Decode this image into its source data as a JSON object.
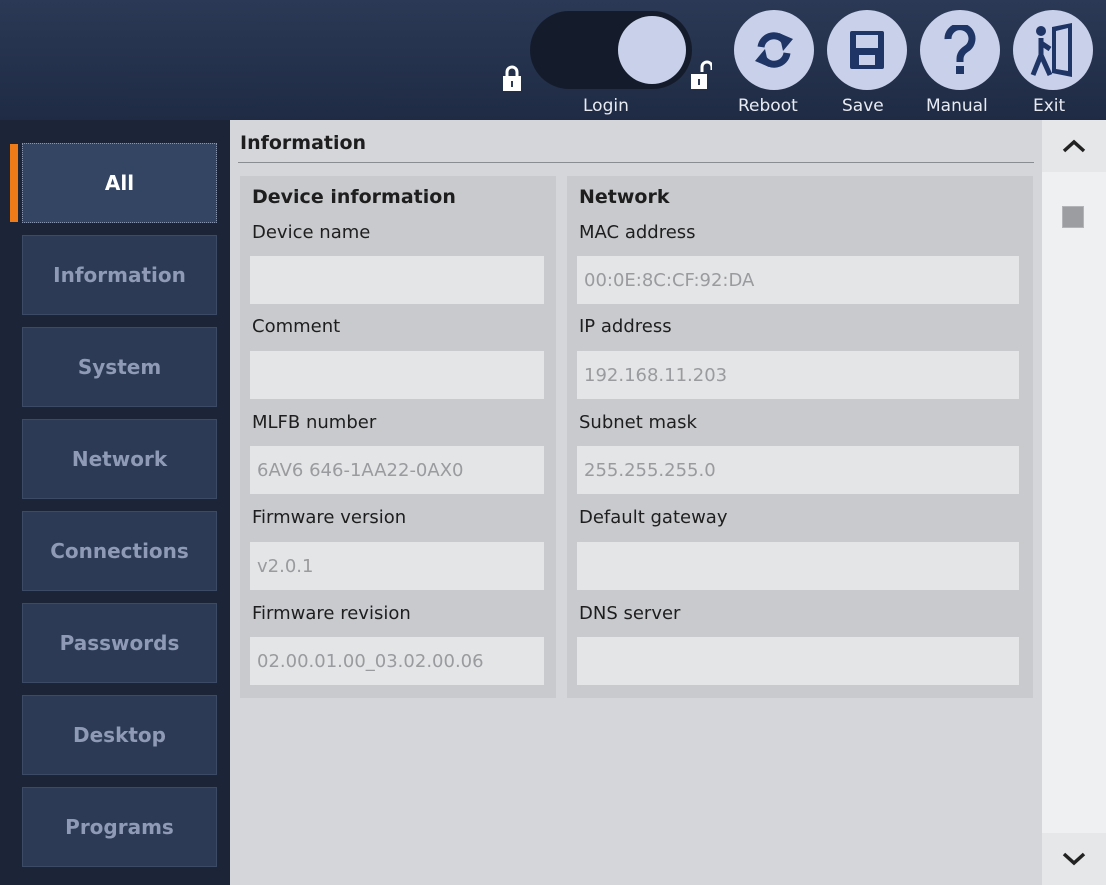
{
  "toolbar": {
    "login_label": "Login",
    "reboot_label": "Reboot",
    "save_label": "Save",
    "manual_label": "Manual",
    "exit_label": "Exit",
    "login_toggle_state": "unlocked"
  },
  "sidebar": {
    "items": [
      {
        "label": "All",
        "active": true
      },
      {
        "label": "Information"
      },
      {
        "label": "System"
      },
      {
        "label": "Network"
      },
      {
        "label": "Connections"
      },
      {
        "label": "Passwords"
      },
      {
        "label": "Desktop"
      },
      {
        "label": "Programs"
      }
    ]
  },
  "main": {
    "section_title": "Information",
    "device": {
      "title": "Device information",
      "device_name_label": "Device name",
      "device_name_value": "",
      "comment_label": "Comment",
      "comment_value": "",
      "mlfb_label": "MLFB number",
      "mlfb_value": "6AV6 646-1AA22-0AX0",
      "fw_version_label": "Firmware version",
      "fw_version_value": "v2.0.1",
      "fw_revision_label": "Firmware revision",
      "fw_revision_value": "02.00.01.00_03.02.00.06"
    },
    "network": {
      "title": "Network",
      "mac_label": "MAC address",
      "mac_value": "00:0E:8C:CF:92:DA",
      "ip_label": "IP address",
      "ip_value": "192.168.11.203",
      "subnet_label": "Subnet mask",
      "subnet_value": "255.255.255.0",
      "gateway_label": "Default gateway",
      "gateway_value": "",
      "dns_label": "DNS server",
      "dns_value": ""
    }
  },
  "colors": {
    "accent": "#ee7a18",
    "topbar": "#2b3956",
    "button_fill": "#c8d0ea",
    "icon_blue": "#1f3565"
  }
}
